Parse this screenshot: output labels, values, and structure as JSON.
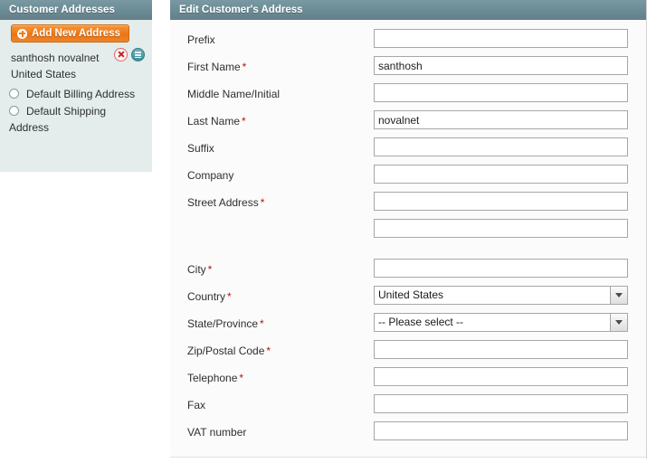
{
  "sidebar": {
    "title": "Customer Addresses",
    "add_button_label": "Add New Address",
    "add_button_icon": "plus-circle-icon",
    "address": {
      "name": "santhosh novalnet",
      "country": "United States",
      "delete_icon": "delete-icon",
      "edit_icon": "edit-icon"
    },
    "defaults": [
      {
        "label": "Default Billing Address",
        "checked": false
      },
      {
        "label": "Default Shipping Address",
        "checked": false
      }
    ]
  },
  "main": {
    "title": "Edit Customer's Address",
    "fields": [
      {
        "label": "Prefix",
        "required": false,
        "type": "text",
        "value": ""
      },
      {
        "label": "First Name",
        "required": true,
        "type": "text",
        "value": "santhosh"
      },
      {
        "label": "Middle Name/Initial",
        "required": false,
        "type": "text",
        "value": ""
      },
      {
        "label": "Last Name",
        "required": true,
        "type": "text",
        "value": "novalnet"
      },
      {
        "label": "Suffix",
        "required": false,
        "type": "text",
        "value": ""
      },
      {
        "label": "Company",
        "required": false,
        "type": "text",
        "value": ""
      },
      {
        "label": "Street Address",
        "required": true,
        "type": "text",
        "value": ""
      },
      {
        "label": "",
        "required": false,
        "type": "text",
        "value": ""
      },
      {
        "label": "City",
        "required": true,
        "type": "text",
        "value": ""
      },
      {
        "label": "Country",
        "required": true,
        "type": "select",
        "value": "United States"
      },
      {
        "label": "State/Province",
        "required": true,
        "type": "select",
        "value": "-- Please select --"
      },
      {
        "label": "Zip/Postal Code",
        "required": true,
        "type": "text",
        "value": ""
      },
      {
        "label": "Telephone",
        "required": true,
        "type": "text",
        "value": ""
      },
      {
        "label": "Fax",
        "required": false,
        "type": "text",
        "value": ""
      },
      {
        "label": "VAT number",
        "required": false,
        "type": "text",
        "value": ""
      }
    ]
  },
  "colors": {
    "header_bar": "#6b8c96",
    "sidebar_panel": "#e4ecec",
    "accent_button": "#ef7c18",
    "required_star": "#b31414",
    "delete_icon": "#cc2020",
    "edit_icon": "#4b9aa8"
  }
}
